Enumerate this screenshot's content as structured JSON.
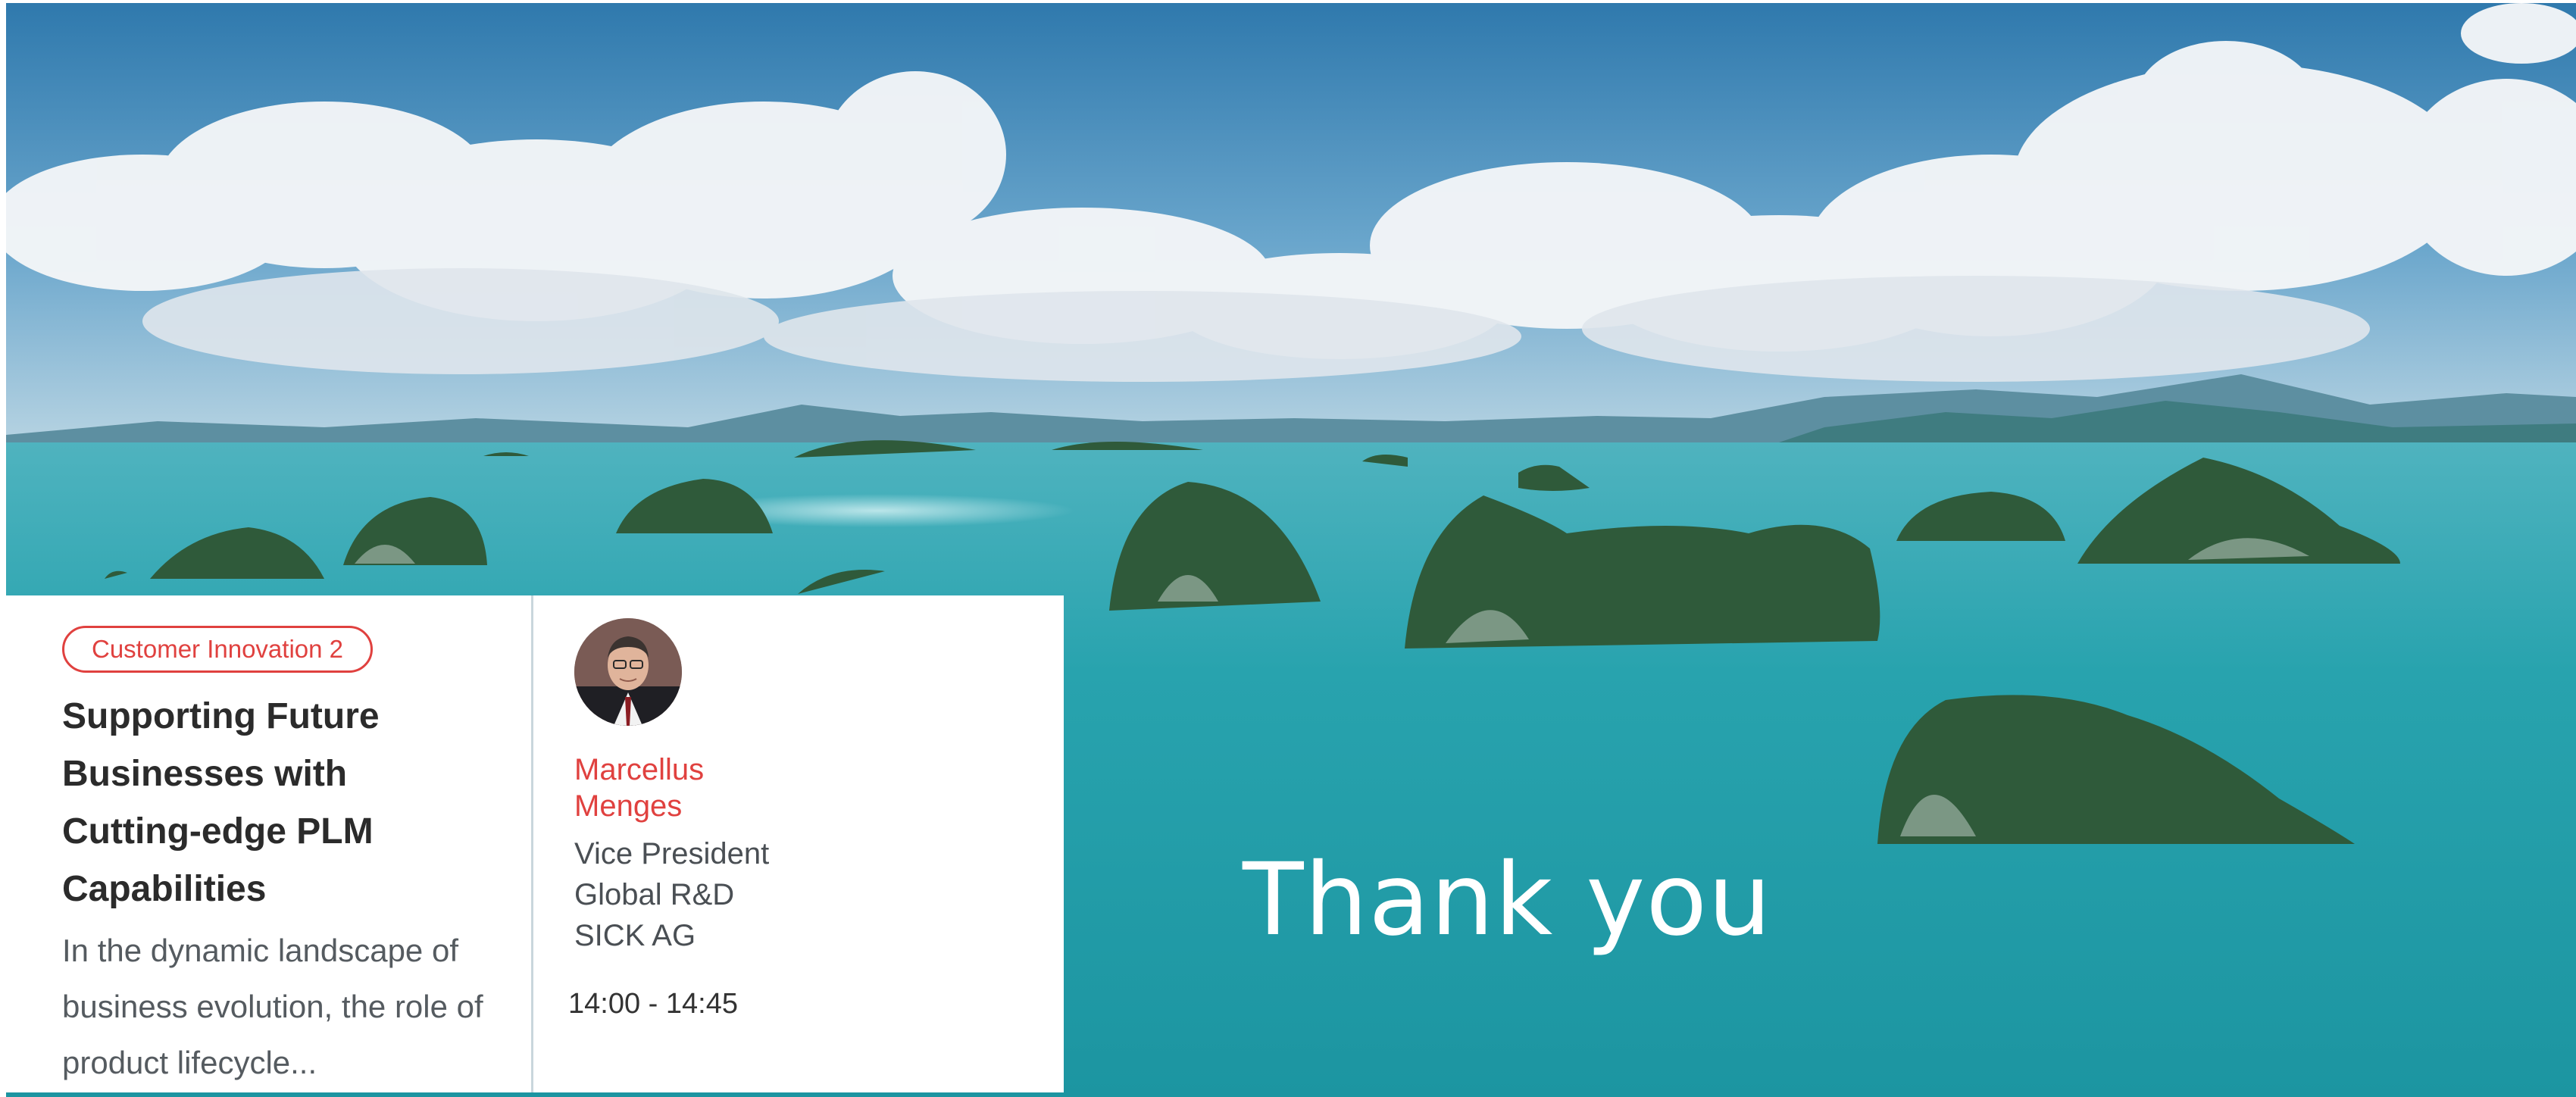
{
  "background": {
    "description_icon": "seascape-photo",
    "sky_color": "#3f87b6",
    "water_color": "#1f9aa6"
  },
  "overlay": {
    "thank_you": "Thank you"
  },
  "session_card": {
    "track_badge": "Customer Innovation 2",
    "title": "Supporting Future Businesses with Cutting-edge PLM Capabilities",
    "description": "In the dynamic landscape of business evolution, the role of product lifecycle...",
    "speaker": {
      "name": "Marcellus Menges",
      "role_line_1": "Vice President",
      "role_line_2": "Global R&D",
      "company": "SICK AG",
      "avatar_icon": "speaker-portrait"
    },
    "time": "14:00 - 14:45",
    "accent_color": "#e0413f"
  }
}
